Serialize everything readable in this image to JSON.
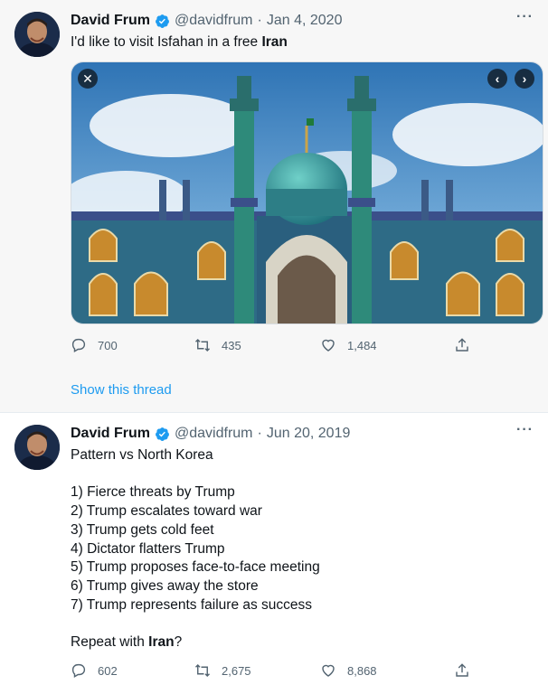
{
  "tweets": [
    {
      "author": {
        "name": "David Frum",
        "handle": "@davidfrum",
        "verified": true
      },
      "date": "Jan 4, 2020",
      "text_before": "I'd like to visit Isfahan in a free ",
      "text_bold": "Iran",
      "text_after": "",
      "media": {
        "icons": [
          "close-icon",
          "chevron-left-icon",
          "chevron-right-icon"
        ]
      },
      "stats": {
        "replies": "700",
        "retweets": "435",
        "likes": "1,484"
      },
      "show_thread": "Show this thread"
    },
    {
      "author": {
        "name": "David Frum",
        "handle": "@davidfrum",
        "verified": true
      },
      "date": "Jun 20, 2019",
      "text_before": "Pattern vs North Korea\n\n1) Fierce threats by Trump\n2) Trump escalates toward war\n3) Trump gets cold feet\n4) Dictator flatters Trump\n5) Trump proposes face-to-face meeting\n6) Trump gives away the store\n7) Trump represents failure as success\n\nRepeat with ",
      "text_bold": "Iran",
      "text_after": "?",
      "stats": {
        "replies": "602",
        "retweets": "2,675",
        "likes": "8,868"
      }
    }
  ],
  "ui": {
    "more_label": "···",
    "separator": "·"
  },
  "colors": {
    "link": "#1d9bf0",
    "verified": "#1d9bf0",
    "muted": "#536471"
  }
}
